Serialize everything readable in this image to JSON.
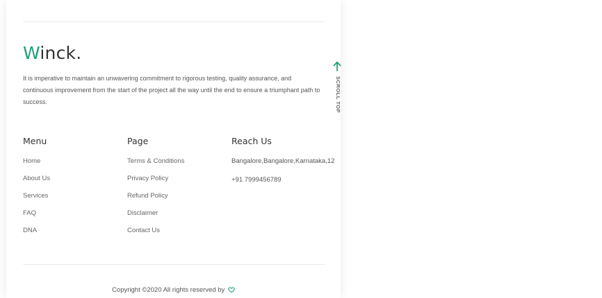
{
  "brand": {
    "logo_initial": "W",
    "logo_rest": "inck.",
    "accent_color": "#1f9e7a"
  },
  "description": "It is imperative to maintain an unwavering commitment to rigorous testing, quality assurance, and continuous improvement from the start of the project all the way until the end to ensure a triumphant path to success.",
  "menu": {
    "title": "Menu",
    "items": [
      "Home",
      "About Us",
      "Services",
      "FAQ",
      "DNA"
    ]
  },
  "page": {
    "title": "Page",
    "items": [
      "Terms & Conditions",
      "Privacy Policy",
      "Refund Policy",
      "Disclaimer",
      "Contact Us"
    ]
  },
  "reach": {
    "title": "Reach Us",
    "address": "Bangalore,Bangalore,Karnataka,12",
    "phone": "+91 7999456789"
  },
  "footer": {
    "copyright": "Copyright ©2020 All rights reserved by",
    "heart_icon": "heart-outline-icon"
  },
  "scroll_top": {
    "label": "SCROLL TOP",
    "icon": "arrow-up-icon"
  }
}
